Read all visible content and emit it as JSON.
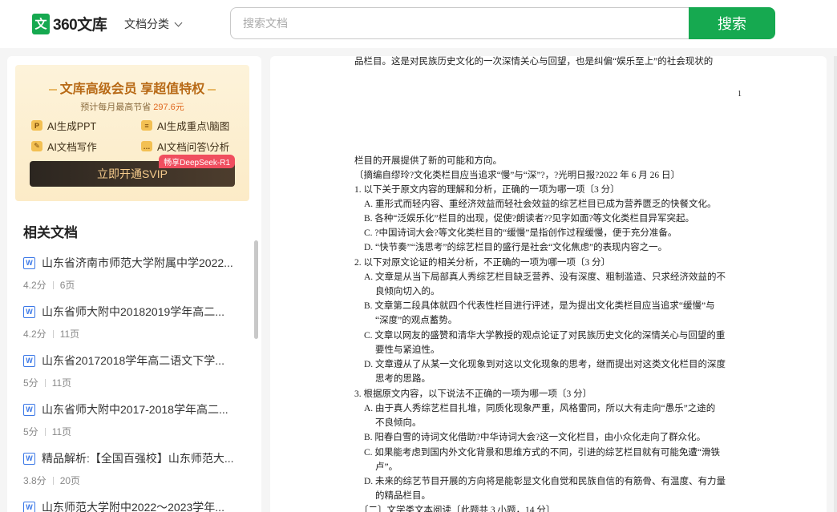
{
  "header": {
    "logo_badge": "文",
    "logo_text": "360文库",
    "category_label": "文档分类",
    "search_placeholder": "搜索文档",
    "search_button": "搜索"
  },
  "promo": {
    "title": "文库高级会员 享超值特权",
    "subtitle_prefix": "预计每月最高节省",
    "subtitle_price": "297.6元",
    "features": [
      {
        "icon": "P",
        "label": "AI生成PPT"
      },
      {
        "icon": "≡",
        "label": "AI生成重点\\脑图"
      },
      {
        "icon": "✎",
        "label": "AI文档写作"
      },
      {
        "icon": "…",
        "label": "AI文档问答\\分析"
      }
    ],
    "cta_label": "立即开通SVIP",
    "cta_badge": "畅享DeepSeek-R1",
    "accent": "#b86a17"
  },
  "related": {
    "title": "相关文档",
    "items": [
      {
        "title": "山东省济南市师范大学附属中学2022...",
        "score": "4.2分",
        "pages": "6页"
      },
      {
        "title": "山东省师大附中20182019学年高二...",
        "score": "4.2分",
        "pages": "11页"
      },
      {
        "title": "山东省20172018学年高二语文下学...",
        "score": "5分",
        "pages": "11页"
      },
      {
        "title": "山东省师大附中2017-2018学年高二...",
        "score": "5分",
        "pages": "11页"
      },
      {
        "title": "精品解析:【全国百强校】山东师范大...",
        "score": "3.8分",
        "pages": "20页"
      },
      {
        "title": "山东师范大学附中2022～2023学年...",
        "score": "",
        "pages": ""
      }
    ]
  },
  "document": {
    "page_number": "1",
    "lines": [
      "品栏目。这是对民族历史文化的一次深情关心与回望，也是纠偏“娱乐至上”的社会现状的",
      "栏目的开展提供了新的可能和方向。",
      "〔摘编自缪玲?文化类栏目应当追求“慢”与“深”?，?光明日报?2022 年 6 月 26 日〕",
      "1. 以下关于原文内容的理解和分析，正确的一项为哪一项〔3 分〕",
      "A. 重形式而轻内容、重经济效益而轻社会效益的综艺栏目已成为营养匮乏的快餐文化。",
      "B. 各种“泛娱乐化”栏目的出现，促使?朗读者??见字如面?等文化类栏目异军突起。",
      "C. ?中国诗词大会?等文化类栏目的“缓慢”是指创作过程缓慢，便于充分准备。",
      "D. “快节奏”“浅思考”的综艺栏目的盛行是社会“文化焦虑”的表现内容之一。",
      "2. 以下对原文论证的相关分析，不正确的一项为哪一项〔3 分〕",
      "A. 文章是从当下局部真人秀综艺栏目缺乏营养、没有深度、粗制滥造、只求经济效益的不",
      "良倾向切入的。",
      "B. 文章第二段具体就四个代表性栏目进行评述，是为提出文化类栏目应当追求“缓慢”与",
      "“深度”的观点蓄势。",
      "C. 文章以网友的盛赞和清华大学教授的观点论证了对民族历史文化的深情关心与回望的重",
      "要性与紧迫性。",
      "D. 文章遵从了从某一文化现象到对这以文化现象的思考，继而提出对这类文化栏目的深度",
      "思考的思路。",
      "3. 根据原文内容，以下说法不正确的一项为哪一项〔3 分〕",
      "A. 由于真人秀综艺栏目扎堆，同质化现象严重，风格雷同，所以大有走向“愚乐”之途的",
      "不良倾向。",
      "B. 阳春白雪的诗词文化借助?中华诗词大会?这一文化栏目，由小众化走向了群众化。",
      "C. 如果能考虑到国内外文化背景和思维方式的不同，引进的综艺栏目就有可能免遭“滑铁",
      "卢”。",
      "D. 未来的综艺节目开展的方向将是能彰显文化自觉和民族自信的有筋骨、有温度、有力量",
      "的精品栏目。",
      "〔二〕文学类文本阅读〔此题共 3 小题，14 分〕"
    ]
  },
  "colors": {
    "brand_green": "#16a950",
    "doc_icon_blue": "#3b78e7"
  }
}
